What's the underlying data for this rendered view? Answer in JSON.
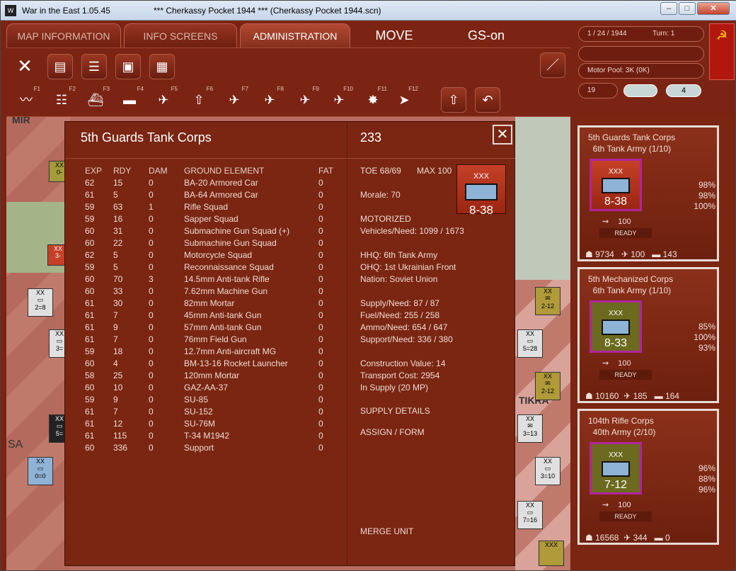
{
  "window": {
    "app_title": "War in the East 1.05.45",
    "scenario_title": "***   Cherkassy Pocket 1944   ***   (Cherkassy Pocket 1944.scn)"
  },
  "tabs": [
    {
      "label": "MAP INFORMATION"
    },
    {
      "label": "INFO SCREENS"
    },
    {
      "label": "ADMINISTRATION"
    }
  ],
  "modes": {
    "move": "MOVE",
    "gs": "GS-on"
  },
  "status": {
    "date": "1 / 24 / 1944",
    "turn": "Turn: 1",
    "motor_pool": "Motor Pool:  3K (0K)",
    "cp": "19",
    "badge": "4"
  },
  "function_keys": [
    "F1",
    "F2",
    "F3",
    "F4",
    "F5",
    "F6",
    "F7",
    "F8",
    "F9",
    "F10",
    "F11",
    "F12"
  ],
  "unit": {
    "name": "5th Guards Tank Corps",
    "id": "233",
    "toe": "TOE 68/69",
    "max": "MAX 100",
    "counter": {
      "size": "XXX",
      "strength": "8-38"
    },
    "morale": "Morale:   70",
    "mobility": "MOTORIZED",
    "vehicles": "Vehicles/Need:   1099 / 1673",
    "hhq": "HHQ: 6th Tank Army",
    "ohq": "OHQ: 1st Ukrainian Front",
    "nation": "Nation:   Soviet Union",
    "supply": "Supply/Need:   87 / 87",
    "fuel": "Fuel/Need:       255 / 258",
    "ammo": "Ammo/Need:    654 / 647",
    "support": "Support/Need:    336 / 380",
    "construction": "Construction Value:  14",
    "transport": "Transport Cost:      2954",
    "in_supply": "In Supply (20 MP)",
    "supply_details": "SUPPLY DETAILS",
    "assign": "ASSIGN / FORM",
    "merge": "MERGE UNIT"
  },
  "columns": {
    "exp": "EXP",
    "rdy": "RDY",
    "dam": "DAM",
    "ge": "GROUND ELEMENT",
    "fat": "FAT"
  },
  "elements": [
    [
      "62",
      "15",
      "0",
      "BA-20 Armored Car",
      "0"
    ],
    [
      "61",
      "5",
      "0",
      "BA-64 Armored Car",
      "0"
    ],
    [
      "59",
      "63",
      "1",
      "Rifle Squad",
      "0"
    ],
    [
      "59",
      "16",
      "0",
      "Sapper Squad",
      "0"
    ],
    [
      "60",
      "31",
      "0",
      "Submachine Gun Squad (+)",
      "0"
    ],
    [
      "60",
      "22",
      "0",
      "Submachine Gun Squad",
      "0"
    ],
    [
      "62",
      "5",
      "0",
      "Motorcycle Squad",
      "0"
    ],
    [
      "59",
      "5",
      "0",
      "Reconnaissance Squad",
      "0"
    ],
    [
      "60",
      "70",
      "3",
      "14.5mm Anti-tank Rifle",
      "0"
    ],
    [
      "60",
      "33",
      "0",
      "7.62mm Machine Gun",
      "0"
    ],
    [
      "61",
      "30",
      "0",
      "82mm Mortar",
      "0"
    ],
    [
      "61",
      "7",
      "0",
      "45mm Anti-tank Gun",
      "0"
    ],
    [
      "61",
      "9",
      "0",
      "57mm Anti-tank Gun",
      "0"
    ],
    [
      "61",
      "7",
      "0",
      "76mm Field Gun",
      "0"
    ],
    [
      "59",
      "18",
      "0",
      "12.7mm Anti-aircraft MG",
      "0"
    ],
    [
      "60",
      "4",
      "0",
      "BM-13-16 Rocket Launcher",
      "0"
    ],
    [
      "58",
      "25",
      "0",
      "120mm Mortar",
      "0"
    ],
    [
      "60",
      "10",
      "0",
      "GAZ-AA-37",
      "0"
    ],
    [
      "59",
      "9",
      "0",
      "SU-85",
      "0"
    ],
    [
      "61",
      "7",
      "0",
      "SU-152",
      "0"
    ],
    [
      "61",
      "12",
      "0",
      "SU-76M",
      "0"
    ],
    [
      "61",
      "115",
      "0",
      "T-34 M1942",
      "0"
    ],
    [
      "60",
      "336",
      "0",
      "Support",
      "0"
    ]
  ],
  "side_cards": [
    {
      "name": "5th Guards Tank Corps",
      "army": "6th Tank Army (1/10)",
      "size": "XXX",
      "strength": "8-38",
      "p1": "98%",
      "p2": "98%",
      "p3": "100%",
      "mp": "100",
      "ready": "READY",
      "men": "9734",
      "guns": "100",
      "afv": "143",
      "color": "red"
    },
    {
      "name": "5th Mechanized Corps",
      "army": "6th Tank Army (1/10)",
      "size": "XXX",
      "strength": "8-33",
      "p1": "85%",
      "p2": "100%",
      "p3": "93%",
      "mp": "100",
      "ready": "READY",
      "men": "10160",
      "guns": "185",
      "afv": "164",
      "color": "olive"
    },
    {
      "name": "104th Rifle Corps",
      "army": "40th Army (2/10)",
      "size": "XXX",
      "strength": "7-12",
      "p1": "96%",
      "p2": "88%",
      "p3": "96%",
      "mp": "100",
      "ready": "READY",
      "men": "16568",
      "guns": "344",
      "afv": "0",
      "color": "olive"
    }
  ],
  "map_counters": [
    {
      "size": "XX",
      "strength": "2=8"
    },
    {
      "size": "XX",
      "strength": "3="
    },
    {
      "size": "XX",
      "strength": "5="
    },
    {
      "size": "XX",
      "strength": "0=0"
    },
    {
      "size": "XX",
      "strength": "2-12"
    },
    {
      "size": "XX",
      "strength": "5=28"
    },
    {
      "size": "XX",
      "strength": "2-12"
    },
    {
      "size": "XX",
      "strength": "3=13"
    },
    {
      "size": "XX",
      "strength": "3=10"
    },
    {
      "size": "XX",
      "strength": "7=16"
    },
    {
      "size": "XXX",
      "strength": ""
    },
    {
      "size": "XX",
      "strength": "0-"
    },
    {
      "size": "XX",
      "strength": "3-"
    }
  ],
  "map_labels": {
    "a": "SA",
    "b": "MIR",
    "c": "TIKRA"
  }
}
